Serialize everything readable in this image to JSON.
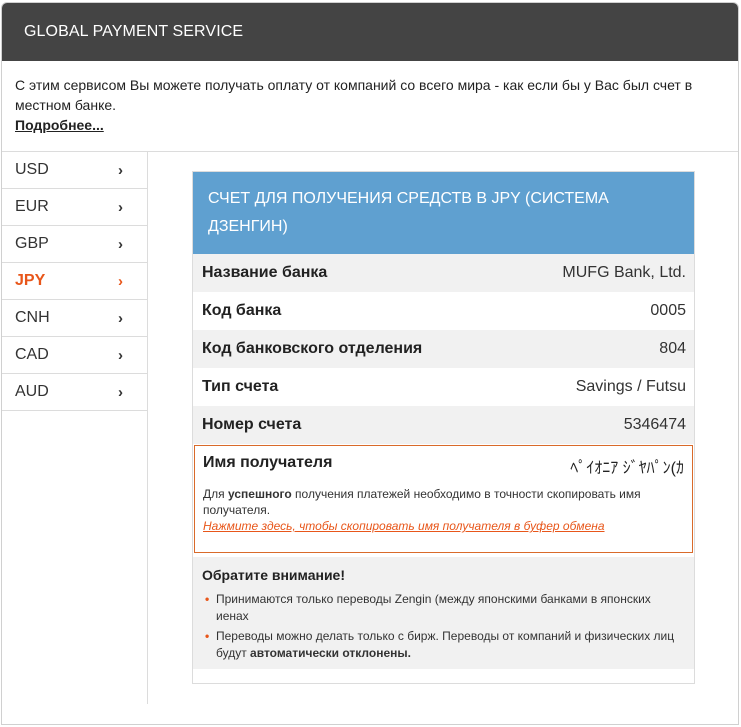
{
  "header": {
    "title": "GLOBAL PAYMENT SERVICE"
  },
  "intro": {
    "text": "С этим сервисом Вы можете получать оплату от компаний со всего мира - как если бы у Вас был счет в местном банке.",
    "more_link": "Подробнее..."
  },
  "sidebar": {
    "items": [
      {
        "label": "USD",
        "active": false
      },
      {
        "label": "EUR",
        "active": false
      },
      {
        "label": "GBP",
        "active": false
      },
      {
        "label": "JPY",
        "active": true
      },
      {
        "label": "CNH",
        "active": false
      },
      {
        "label": "CAD",
        "active": false
      },
      {
        "label": "AUD",
        "active": false
      }
    ],
    "chevron": "›"
  },
  "panel": {
    "title": "СЧЕТ ДЛЯ ПОЛУЧЕНИЯ СРЕДСТВ В JPY (СИСТЕМА ДЗЕНГИН)",
    "rows": [
      {
        "label": "Название банка",
        "value": "MUFG Bank, Ltd."
      },
      {
        "label": "Код банка",
        "value": "0005"
      },
      {
        "label": "Код банковского отделения",
        "value": "804"
      },
      {
        "label": "Тип счета",
        "value": "Savings / Futsu"
      },
      {
        "label": "Номер счета",
        "value": "5346474"
      }
    ],
    "recipient": {
      "label": "Имя получателя",
      "value": "ﾍﾟｲｵﾆｱ ｼﾞﾔﾊﾟﾝ(ｶ",
      "note_prefix": "Для ",
      "note_bold": "успешного",
      "note_suffix": " получения платежей необходимо в точности скопировать имя получателя.",
      "copy_link": "Нажмите здесь, чтобы скопировать имя получателя в буфер обмена"
    },
    "notice": {
      "title": "Обратите внимание!",
      "items": [
        {
          "text": "Принимаются только переводы Zengin (между японскими банками в японских иенах",
          "bold": ""
        },
        {
          "text": "Переводы можно делать только с бирж. Переводы от компаний и физических лиц будут ",
          "bold": "автоматически отклонены."
        }
      ]
    }
  },
  "colors": {
    "header_bg": "#444444",
    "panel_head_bg": "#5fa0d0",
    "accent": "#e8561a"
  }
}
